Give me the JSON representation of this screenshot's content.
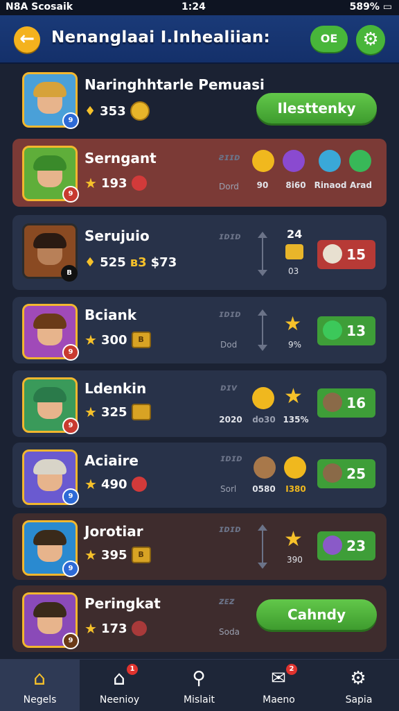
{
  "status_bar": {
    "left": "N8A Scosaik",
    "time": "1:24",
    "battery": "589%"
  },
  "header": {
    "title": "Nenanglaai I.Inhealiian:",
    "badge": "OE"
  },
  "players": [
    {
      "name": "Naringhhtarle Pemuasi",
      "score": "353",
      "button": "Ilesttenky"
    },
    {
      "name": "Serngant",
      "score": "193",
      "ghost": "ƨɪɪᴅ",
      "ghost2": "Dord",
      "icon_labels": [
        "90",
        "8i60",
        "Rinaod",
        "Arad"
      ]
    },
    {
      "name": "Serujuio",
      "score": "525",
      "extra1": "ʙ3",
      "extra2": "$73",
      "ghost": "ɪᴅɪᴅ",
      "num_top": "24",
      "num_bottom": "03",
      "reward": "15"
    },
    {
      "name": "Bciank",
      "score": "300",
      "ghost": "ɪᴅɪᴅ",
      "ghost2": "Dod",
      "num_bottom": "9%",
      "reward": "13"
    },
    {
      "name": "Ldenkin",
      "score": "325",
      "ghost": "ᴅɪᴠ",
      "icon_labels": [
        "2020",
        "do30",
        "135%"
      ],
      "reward": "16"
    },
    {
      "name": "Aciaire",
      "score": "490",
      "ghost": "ɪᴅɪᴅ",
      "ghost2": "Sorl",
      "icon_labels": [
        "0580",
        "I380"
      ],
      "reward": "25"
    },
    {
      "name": "Jorotiar",
      "score": "395",
      "ghost": "ɪᴅɪᴅ",
      "num_bottom": "390",
      "reward": "23"
    },
    {
      "name": "Peringkat",
      "score": "173",
      "ghost": "ᴢᴇᴢ",
      "ghost2": "Soda",
      "button": "Cahndy"
    }
  ],
  "nav": [
    {
      "label": "Negels",
      "badge": ""
    },
    {
      "label": "Neenioy",
      "badge": "1"
    },
    {
      "label": "Mislait",
      "badge": ""
    },
    {
      "label": "Maeno",
      "badge": "2"
    },
    {
      "label": "Sapia",
      "badge": ""
    }
  ],
  "colors": {
    "accent_green": "#48b63a",
    "header_blue": "#1a3a78",
    "gold": "#f2b72e",
    "red_card": "#7b3a36"
  }
}
